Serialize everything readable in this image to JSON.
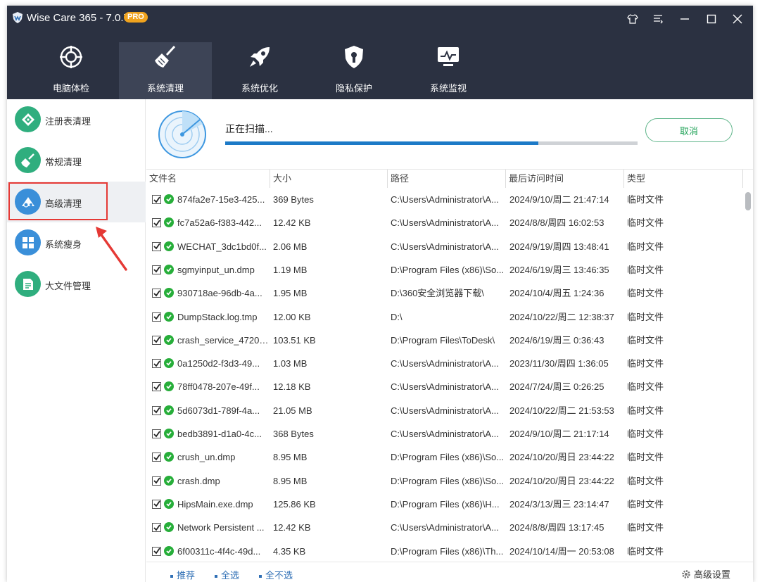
{
  "window": {
    "title": "Wise Care 365 - 7.0.7",
    "badge": "PRO",
    "controls": [
      "skin-icon",
      "menu-icon",
      "minimize-icon",
      "maximize-icon",
      "close-icon"
    ]
  },
  "nav": {
    "tabs": [
      {
        "label": "电脑体检",
        "icon": "crosshair-icon",
        "active": false
      },
      {
        "label": "系统清理",
        "icon": "broom-icon",
        "active": true
      },
      {
        "label": "系统优化",
        "icon": "rocket-icon",
        "active": false
      },
      {
        "label": "隐私保护",
        "icon": "shield-icon",
        "active": false
      },
      {
        "label": "系统监视",
        "icon": "monitor-icon",
        "active": false
      }
    ]
  },
  "sidebar": {
    "items": [
      {
        "label": "注册表清理",
        "icon": "registry-icon",
        "color": "#2fae7e"
      },
      {
        "label": "常规清理",
        "icon": "brush-icon",
        "color": "#2fae7e"
      },
      {
        "label": "高级清理",
        "icon": "advanced-clean-icon",
        "color": "#3a8fd9",
        "active": true
      },
      {
        "label": "系统瘦身",
        "icon": "windows-icon",
        "color": "#3a8fd9"
      },
      {
        "label": "大文件管理",
        "icon": "file-icon",
        "color": "#2fae7e"
      }
    ]
  },
  "scan": {
    "status": "正在扫描...",
    "progress_percent": 76,
    "cancel_label": "取消"
  },
  "table": {
    "columns": [
      "文件名",
      "大小",
      "路径",
      "最后访问时间",
      "类型"
    ],
    "rows": [
      {
        "name": "874fa2e7-15e3-425...",
        "size": "369 Bytes",
        "path": "C:\\Users\\Administrator\\A...",
        "time": "2024/9/10/周二 21:47:14",
        "type": "临时文件"
      },
      {
        "name": "fc7a52a6-f383-442...",
        "size": "12.42 KB",
        "path": "C:\\Users\\Administrator\\A...",
        "time": "2024/8/8/周四 16:02:53",
        "type": "临时文件"
      },
      {
        "name": "WECHAT_3dc1bd0f...",
        "size": "2.06 MB",
        "path": "C:\\Users\\Administrator\\A...",
        "time": "2024/9/19/周四 13:48:41",
        "type": "临时文件"
      },
      {
        "name": "sgmyinput_un.dmp",
        "size": "1.19 MB",
        "path": "D:\\Program Files (x86)\\So...",
        "time": "2024/6/19/周三 13:46:35",
        "type": "临时文件"
      },
      {
        "name": "930718ae-96db-4a...",
        "size": "1.95 MB",
        "path": "D:\\360安全浏览器下载\\",
        "time": "2024/10/4/周五 1:24:36",
        "type": "临时文件"
      },
      {
        "name": "DumpStack.log.tmp",
        "size": "12.00 KB",
        "path": "D:\\",
        "time": "2024/10/22/周二 12:38:37",
        "type": "临时文件"
      },
      {
        "name": "crash_service_4720_...",
        "size": "103.51 KB",
        "path": "D:\\Program Files\\ToDesk\\",
        "time": "2024/6/19/周三 0:36:43",
        "type": "临时文件"
      },
      {
        "name": "0a1250d2-f3d3-49...",
        "size": "1.03 MB",
        "path": "C:\\Users\\Administrator\\A...",
        "time": "2023/11/30/周四 1:36:05",
        "type": "临时文件"
      },
      {
        "name": "78ff0478-207e-49f...",
        "size": "12.18 KB",
        "path": "C:\\Users\\Administrator\\A...",
        "time": "2024/7/24/周三 0:26:25",
        "type": "临时文件"
      },
      {
        "name": "5d6073d1-789f-4a...",
        "size": "21.05 MB",
        "path": "C:\\Users\\Administrator\\A...",
        "time": "2024/10/22/周二 21:53:53",
        "type": "临时文件"
      },
      {
        "name": "bedb3891-d1a0-4c...",
        "size": "368 Bytes",
        "path": "C:\\Users\\Administrator\\A...",
        "time": "2024/9/10/周二 21:17:14",
        "type": "临时文件"
      },
      {
        "name": "crush_un.dmp",
        "size": "8.95 MB",
        "path": "D:\\Program Files (x86)\\So...",
        "time": "2024/10/20/周日 23:44:22",
        "type": "临时文件"
      },
      {
        "name": "crash.dmp",
        "size": "8.95 MB",
        "path": "D:\\Program Files (x86)\\So...",
        "time": "2024/10/20/周日 23:44:22",
        "type": "临时文件"
      },
      {
        "name": "HipsMain.exe.dmp",
        "size": "125.86 KB",
        "path": "D:\\Program Files (x86)\\H...",
        "time": "2024/3/13/周三 23:14:47",
        "type": "临时文件"
      },
      {
        "name": "Network Persistent ...",
        "size": "12.42 KB",
        "path": "C:\\Users\\Administrator\\A...",
        "time": "2024/8/8/周四 13:17:45",
        "type": "临时文件"
      },
      {
        "name": "6f00311c-4f4c-49d...",
        "size": "4.35 KB",
        "path": "D:\\Program Files (x86)\\Th...",
        "time": "2024/10/14/周一 20:53:08",
        "type": "临时文件"
      }
    ]
  },
  "footer": {
    "recommend": "推荐",
    "select_all": "全选",
    "select_none": "全不选",
    "advanced_settings": "高级设置"
  }
}
